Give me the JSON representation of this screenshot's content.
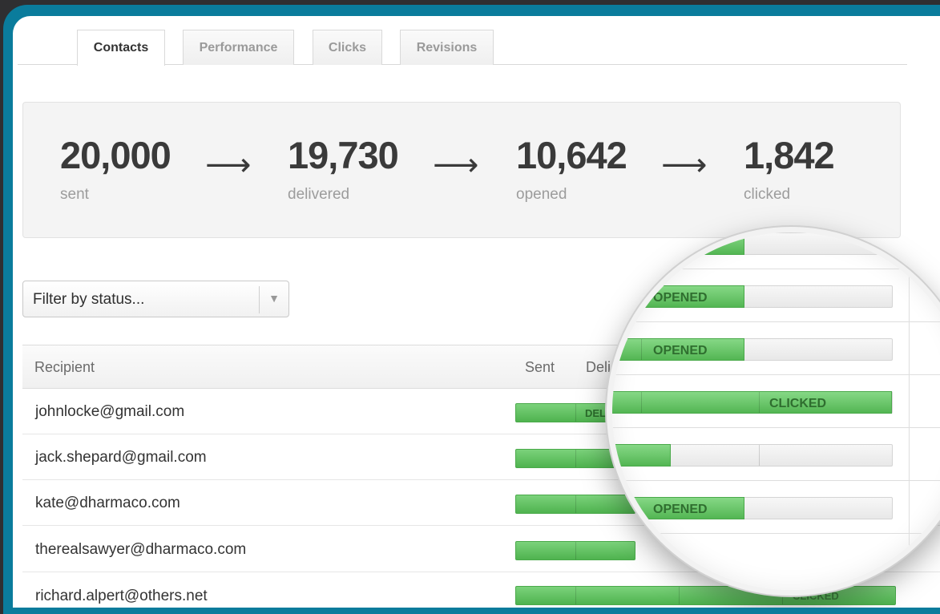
{
  "tabs": [
    {
      "label": "Contacts",
      "active": true
    },
    {
      "label": "Performance",
      "active": false
    },
    {
      "label": "Clicks",
      "active": false
    },
    {
      "label": "Revisions",
      "active": false
    }
  ],
  "stats": [
    {
      "value": "20,000",
      "label": "sent"
    },
    {
      "value": "19,730",
      "label": "delivered"
    },
    {
      "value": "10,642",
      "label": "opened"
    },
    {
      "value": "1,842",
      "label": "clicked"
    }
  ],
  "arrow_glyph": "⟶",
  "filter": {
    "placeholder": "Filter by status...",
    "caret": "▼"
  },
  "table": {
    "columns": {
      "recipient": "Recipient",
      "sent": "Sent",
      "delivered": "Deli"
    },
    "rows": [
      {
        "email": "johnlocke@gmail.com",
        "badge": "DEL"
      },
      {
        "email": "jack.shepard@gmail.com",
        "badge": ""
      },
      {
        "email": "kate@dharmaco.com",
        "badge": ""
      },
      {
        "email": "therealsawyer@dharmaco.com",
        "badge": ""
      },
      {
        "email": "richard.alpert@others.net",
        "badge": "CLICKED"
      }
    ]
  },
  "magnifier": {
    "rows": [
      {
        "label": "OPENED",
        "fill_fraction": 0.5
      },
      {
        "label": "OPENED",
        "fill_fraction": 0.5
      },
      {
        "label": "OPENED",
        "fill_fraction": 0.5
      },
      {
        "label": "CLICKED",
        "fill_fraction": 1.0
      },
      {
        "label": "",
        "fill_fraction": 0.25
      },
      {
        "label": "OPENED",
        "fill_fraction": 0.5
      }
    ]
  },
  "colors": {
    "accent_frame": "#0a7c9c",
    "status_green": "#5cbf5c"
  }
}
